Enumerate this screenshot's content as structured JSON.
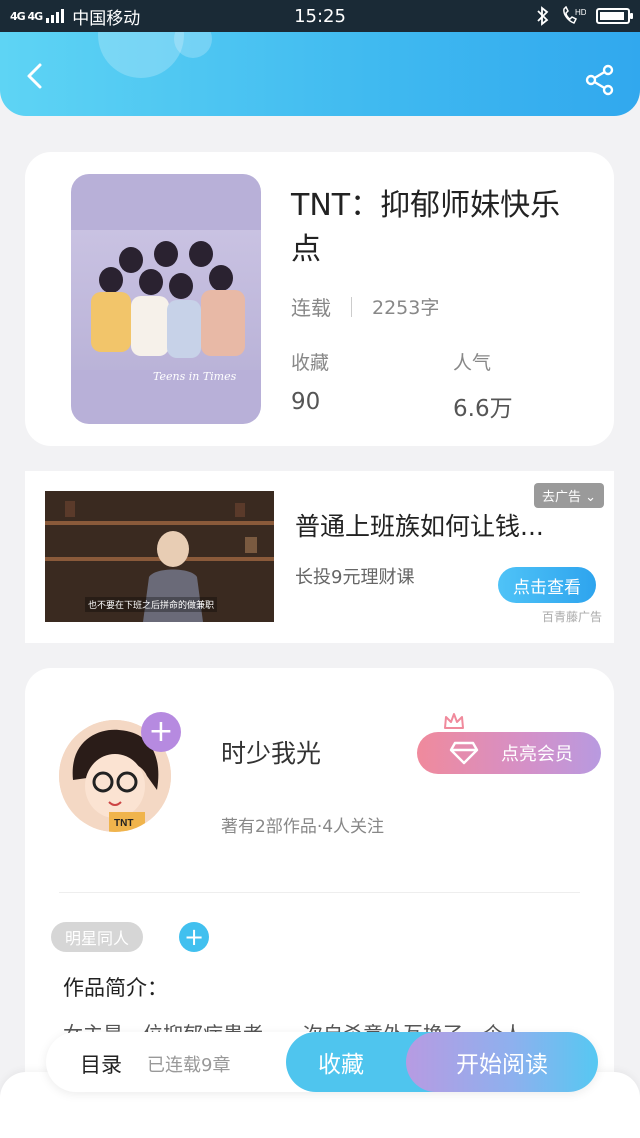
{
  "status_bar": {
    "network": "4G 4G",
    "carrier": "中国移动",
    "time": "15:25",
    "icons": [
      "bluetooth-icon",
      "hd-call-icon",
      "battery-icon"
    ]
  },
  "header": {
    "back_icon": "back-arrow-icon",
    "share_icon": "share-icon"
  },
  "book": {
    "title": "TNT：抑郁师妹快乐点",
    "cover_caption": "Teens in Times",
    "status": "连载",
    "word_count": "2253字",
    "stats": [
      {
        "label": "收藏",
        "value": "90"
      },
      {
        "label": "人气",
        "value": "6.6万"
      }
    ]
  },
  "ad": {
    "close_label": "去广告",
    "title": "普通上班族如何让钱...",
    "description": "长投9元理财课",
    "cta_label": "点击查看",
    "source": "百青藤广告",
    "thumb_subtitle": "也不要在下班之后拼命的做兼职"
  },
  "author": {
    "name": "时少我光",
    "meta": "著有2部作品·4人关注",
    "vip_label": "点亮会员",
    "follow_symbol": "+"
  },
  "tags": {
    "items": [
      "明星同人"
    ],
    "add_symbol": "+"
  },
  "intro": {
    "title": "作品简介：",
    "text": "女主是一位抑郁症患者，一次自杀意外互换了一个人"
  },
  "bottom_bar": {
    "toc_label": "目录",
    "chapters": "已连载9章",
    "favorite_label": "收藏",
    "read_label": "开始阅读"
  },
  "colors": {
    "accent": "#3fb9f0",
    "vip_start": "#f08a9c",
    "vip_end": "#b89ae0"
  }
}
